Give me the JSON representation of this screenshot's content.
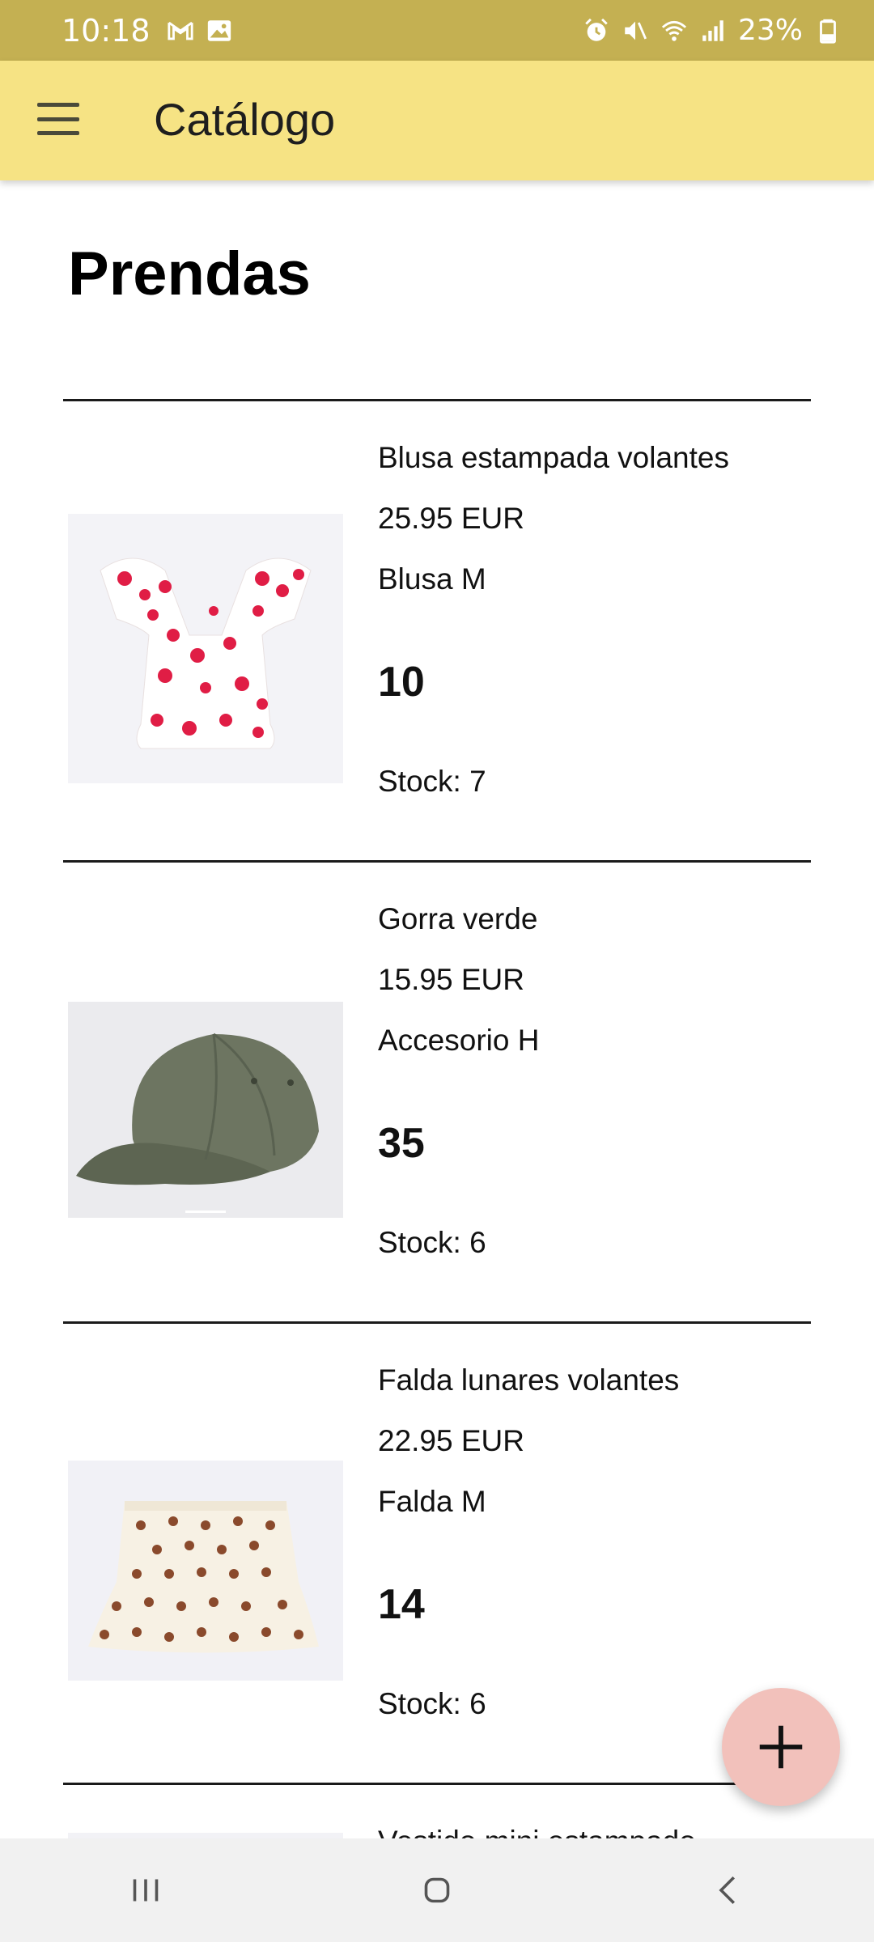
{
  "status_bar": {
    "time": "10:18",
    "battery": "23%",
    "left_icons": [
      "gmail-icon",
      "gallery-icon"
    ],
    "right_icons": [
      "alarm-icon",
      "mute-icon",
      "wifi-icon",
      "signal-icon",
      "battery-icon"
    ]
  },
  "app_bar": {
    "title": "Catálogo",
    "background": "#f6e384"
  },
  "page": {
    "heading": "Prendas"
  },
  "items": [
    {
      "name": "Blusa estampada volantes",
      "price": "25.95 EUR",
      "category": "Blusa M",
      "quantity": "10",
      "stock": "Stock: 7",
      "image": "floral-blouse-image"
    },
    {
      "name": "Gorra verde",
      "price": "15.95 EUR",
      "category": "Accesorio H",
      "quantity": "35",
      "stock": "Stock: 6",
      "image": "green-cap-image"
    },
    {
      "name": "Falda lunares volantes",
      "price": "22.95 EUR",
      "category": "Falda M",
      "quantity": "14",
      "stock": "Stock: 6",
      "image": "polka-dot-skirt-image"
    },
    {
      "name": "Vestido mini estampado"
    }
  ],
  "fab": {
    "icon": "plus-icon",
    "color": "#f2c1bb"
  },
  "nav_bar": {
    "buttons": [
      "recent-apps-icon",
      "home-icon",
      "back-icon"
    ]
  }
}
